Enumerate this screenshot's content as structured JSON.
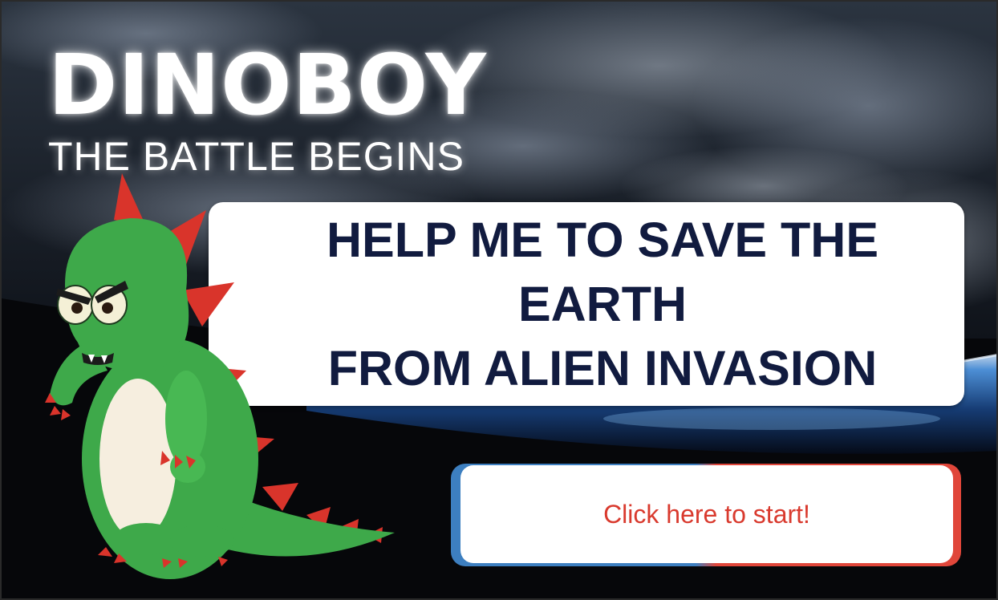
{
  "game": {
    "title": "DINOBOY",
    "subtitle": "THE BATTLE BEGINS",
    "message_line1": "HELP ME TO SAVE THE EARTH",
    "message_line2": "FROM ALIEN INVASION",
    "start_label": "Click here to start!"
  },
  "colors": {
    "message_text": "#111b3f",
    "start_text": "#d93a2e",
    "dino_green": "#3ea94a",
    "dino_spikes": "#d9342b",
    "start_border_left": "#3d7fc0",
    "start_border_right": "#e0463a"
  }
}
